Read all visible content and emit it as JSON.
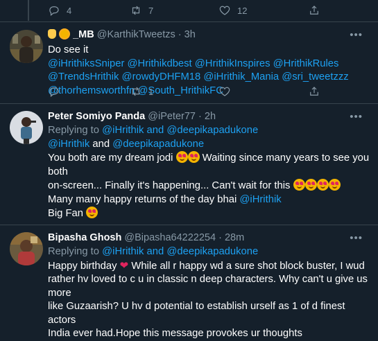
{
  "top_actions": {
    "reply_count": "4",
    "retweet_count": "7",
    "like_count": "12"
  },
  "tweets": [
    {
      "name": "_MB",
      "handle": "@KarthikTweetzs",
      "time": "3h",
      "lines": [
        "Do see it",
        "@iHrithiksSniper @Hrithikdbest @HrithikInspires @HrithikRules",
        "@TrendsHrithik @rowdyDHFM18 @iHrithik_Mania @sri_tweetzzz",
        "@thorhemsworthfn @South_HrithikFC"
      ],
      "retweet_count": "1"
    },
    {
      "name": "Peter Somiyo Panda",
      "handle": "@iPeter77",
      "time": "2h",
      "replying_to_prefix": "Replying to",
      "replying_to_user1": "@iHrithik",
      "replying_to_and": "and",
      "replying_to_user2": "@deepikapadukone",
      "line1": "You both are my dream jodi",
      "line1b": "Waiting since many years to see you both",
      "line2": "on-screen... Finally it's happening... Can't wait for this",
      "line3_text": "Many many happy returns of the day bhai",
      "line3_link": "@iHrithik",
      "line4": "Big Fan"
    },
    {
      "name": "Bipasha Ghosh",
      "handle": "@Bipasha64222254",
      "time": "28m",
      "replying_to_prefix": "Replying to",
      "replying_to_user1": "@iHrithik",
      "replying_to_and": "and",
      "replying_to_user2": "@deepikapadukone",
      "line1a": "Happy birthday",
      "line1b": "While all r happy wd a sure shot block buster, I wud",
      "line2": "rather hv loved to c u in classic n deep characters. Why can't u give us more",
      "line3": "like Guzaarish? U hv d potential to establish urself as 1 of d finest actors",
      "line4": "India ever had.Hope this message provokes ur thoughts"
    }
  ],
  "common": {
    "dot": "·",
    "more": "•••"
  },
  "colors": {
    "background": "#15202b",
    "link": "#1da1f2",
    "muted": "#8899a6",
    "divider": "#38444d"
  }
}
